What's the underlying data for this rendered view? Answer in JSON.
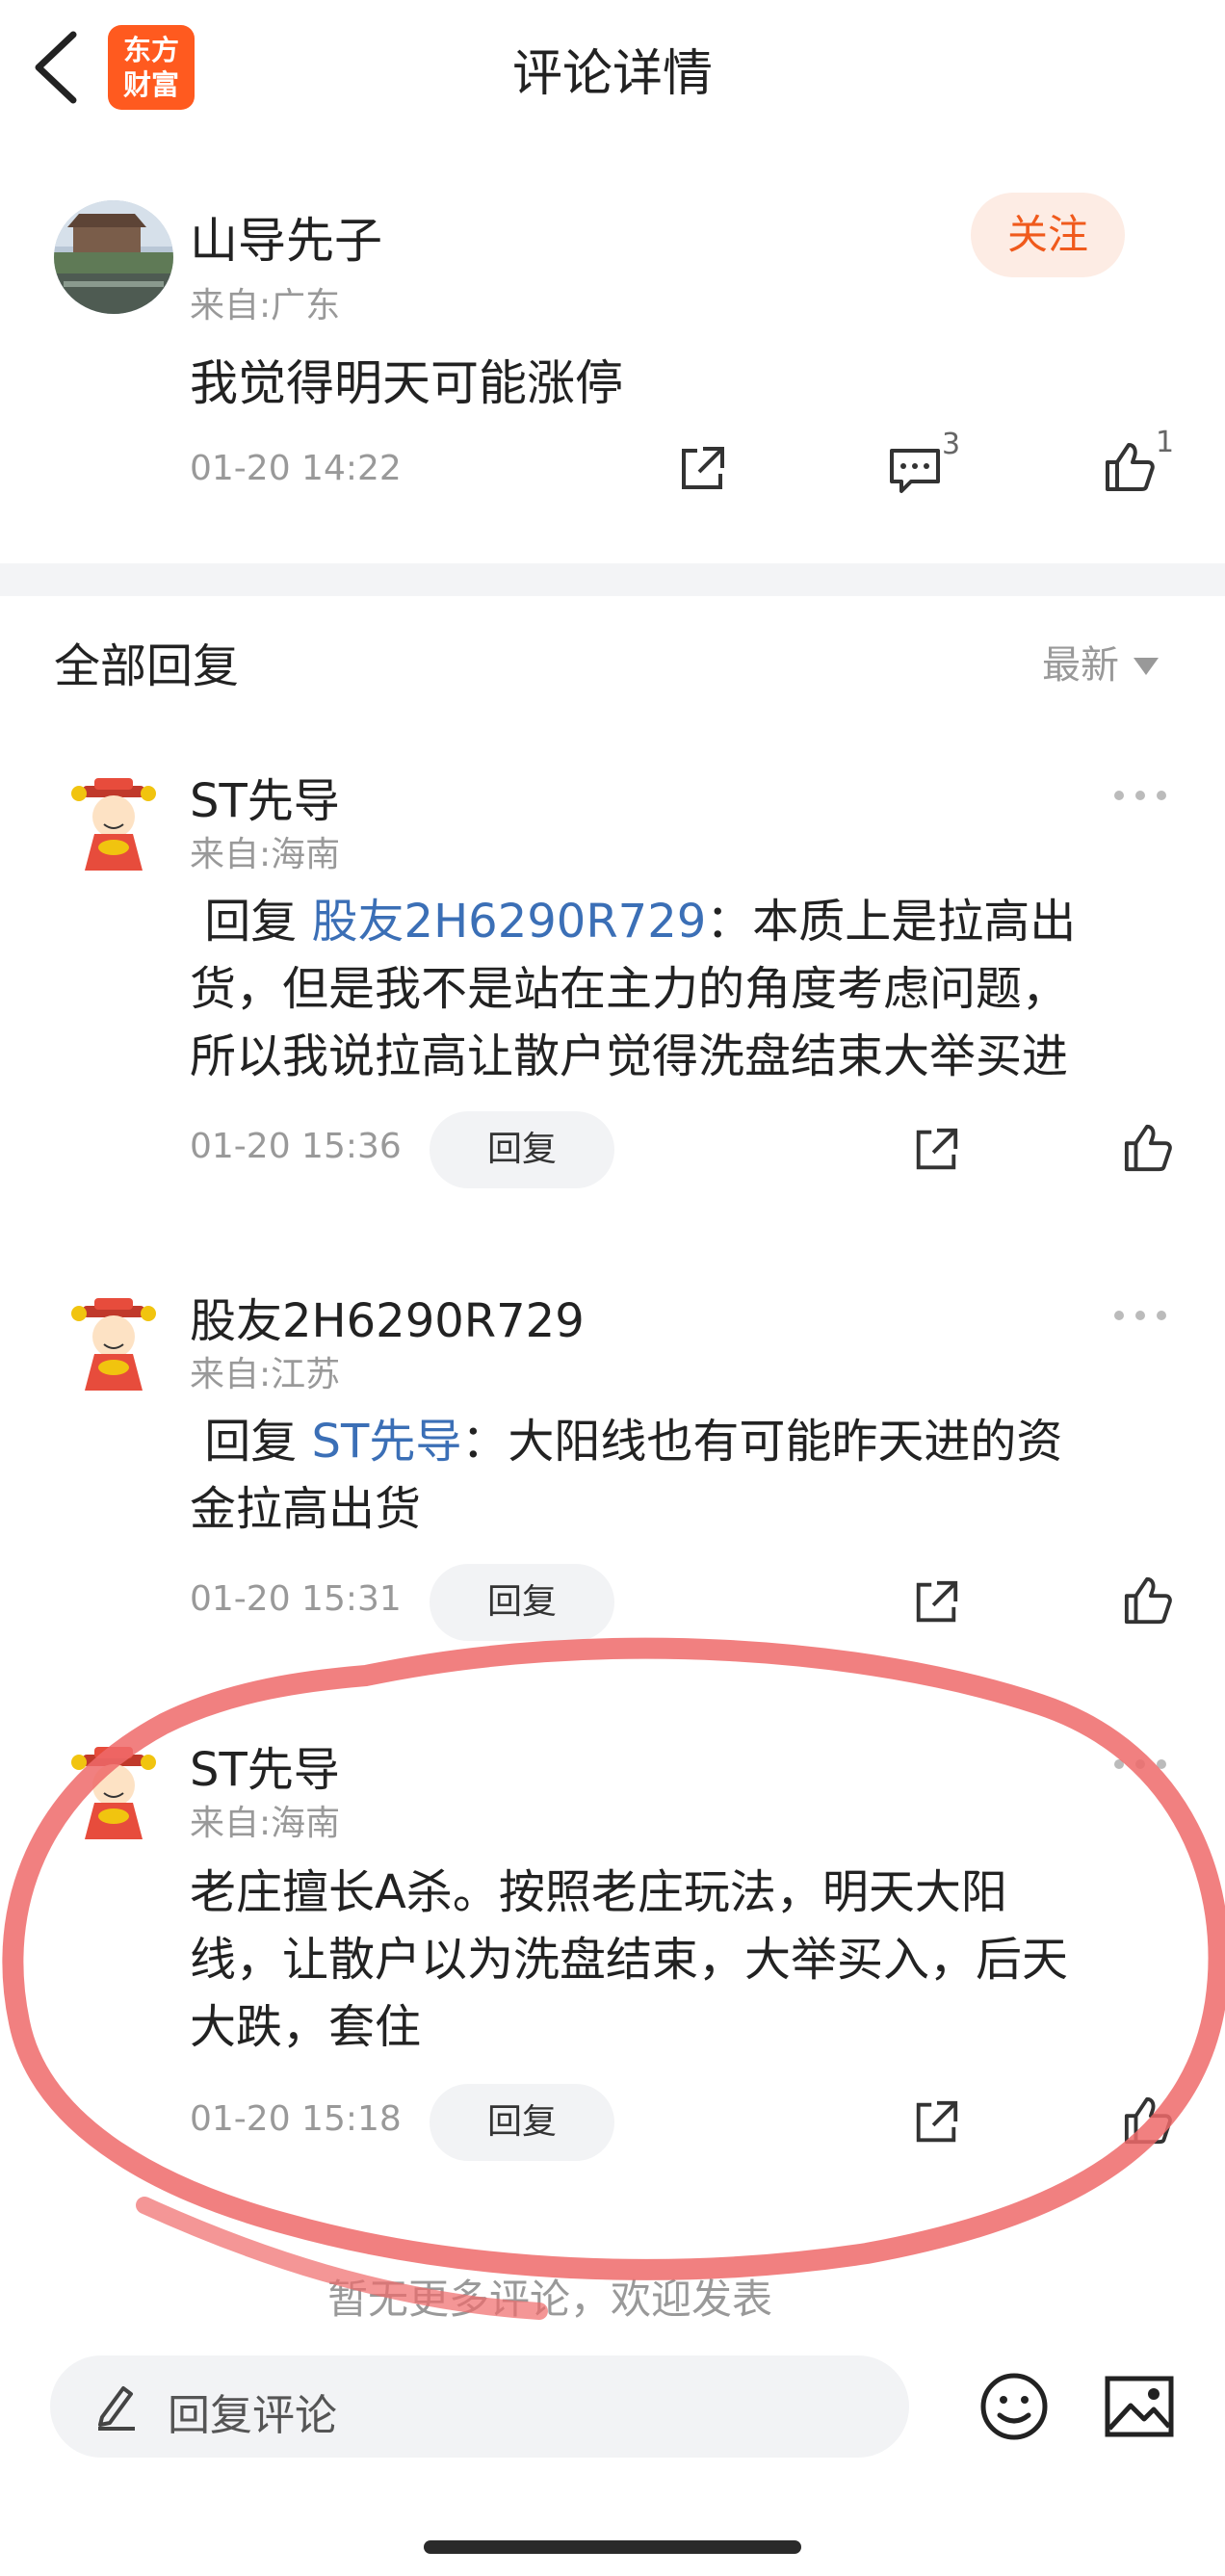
{
  "header": {
    "title": "评论详情",
    "logo_line1": "东方",
    "logo_line2": "财富"
  },
  "post": {
    "author": "山导先子",
    "from": "来自:广东",
    "follow_label": "关注",
    "text": "我觉得明天可能涨停",
    "time": "01-20 14:22",
    "comment_count": "3",
    "like_count": "1"
  },
  "replies_section": {
    "title": "全部回复",
    "sort_label": "最新"
  },
  "replies": [
    {
      "name": "ST先导",
      "from": "来自:海南",
      "reply_prefix": "回复 ",
      "reply_to": "股友2H6290R729",
      "line1": "：本质上是拉高出",
      "line2": "货，但是我不是站在主力的角度考虑问题，",
      "line3": "所以我说拉高让散户觉得洗盘结束大举买进",
      "time": "01-20 15:36",
      "reply_label": "回复"
    },
    {
      "name": "股友2H6290R729",
      "from": "来自:江苏",
      "reply_prefix": "回复 ",
      "reply_to": "ST先导",
      "line1": "：大阳线也有可能昨天进的资",
      "line2": "金拉高出货",
      "time": "01-20 15:31",
      "reply_label": "回复"
    },
    {
      "name": "ST先导",
      "from": "来自:海南",
      "line1": "老庄擅长A杀。按照老庄玩法，明天大阳",
      "line2": "线，让散户以为洗盘结束，大举买入，后天",
      "line3": "大跌，套住",
      "time": "01-20 15:18",
      "reply_label": "回复"
    }
  ],
  "footer": {
    "no_more": "暂无更多评论，欢迎发表",
    "input_placeholder": "回复评论"
  },
  "colors": {
    "accent": "#f05a1c",
    "link": "#3b6fb6",
    "annotation": "#ef6a6a"
  }
}
